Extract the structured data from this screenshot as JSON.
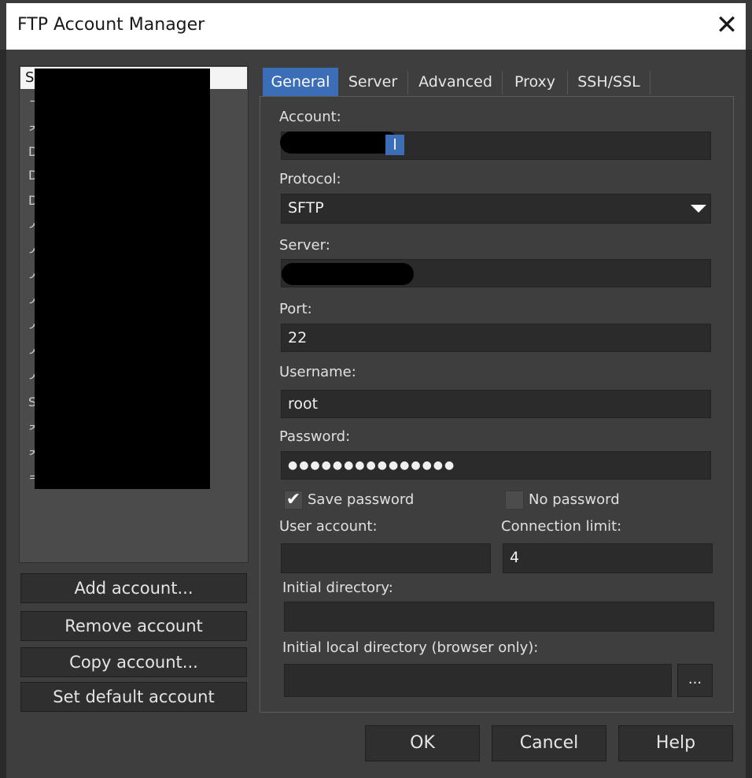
{
  "window": {
    "title": "FTP Account Manager",
    "close_glyph": "✕"
  },
  "accounts": {
    "first_label": "S",
    "letters": [
      "ᄀ",
      "ᄌ",
      "D",
      "D",
      "D",
      "ᄉ",
      "ᄉ",
      "ᄉ",
      "ᄉ",
      "ᄉ",
      "ᄉ",
      "ᄉ",
      "S",
      "ᄌ",
      "ᄌ",
      "ᄏ"
    ]
  },
  "side_buttons": [
    "Add account...",
    "Remove account",
    "Copy account...",
    "Set default account"
  ],
  "tabs": [
    "General",
    "Server",
    "Advanced",
    "Proxy",
    "SSH/SSL"
  ],
  "active_tab": "General",
  "general": {
    "account_label": "Account:",
    "account_value_tail": "l",
    "protocol_label": "Protocol:",
    "protocol_value": "SFTP",
    "server_label": "Server:",
    "port_label": "Port:",
    "port_value": "22",
    "username_label": "Username:",
    "username_value": "root",
    "password_label": "Password:",
    "password_value": "●●●●●●●●●●●●●●●",
    "save_password_label": "Save password",
    "save_password_checked": true,
    "no_password_label": "No password",
    "no_password_checked": false,
    "user_account_label": "User account:",
    "user_account_value": "",
    "connection_limit_label": "Connection limit:",
    "connection_limit_value": "4",
    "initial_dir_label": "Initial directory:",
    "initial_dir_value": "",
    "initial_local_dir_label": "Initial local directory (browser only):",
    "initial_local_dir_value": "",
    "browse_label": "..."
  },
  "footer": {
    "ok": "OK",
    "cancel": "Cancel",
    "help": "Help"
  },
  "colors": {
    "active_tab": "#3c6db7",
    "background": "#3e3e3e",
    "field": "#2b2b2b"
  }
}
